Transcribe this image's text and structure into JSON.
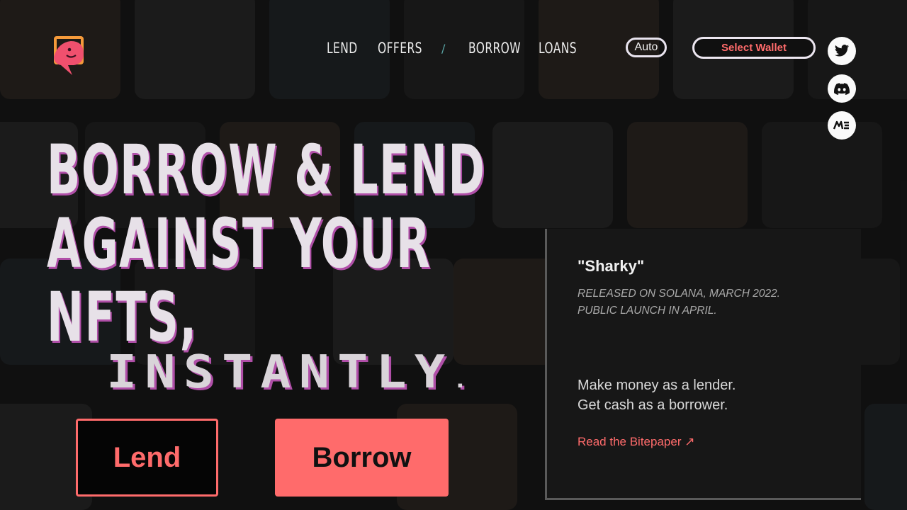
{
  "nav": {
    "items": [
      {
        "label": "LEND"
      },
      {
        "label": "OFFERS"
      },
      {
        "label": "BORROW"
      },
      {
        "label": "LOANS"
      }
    ],
    "separator": "/"
  },
  "theme_toggle": {
    "label": "Auto"
  },
  "wallet": {
    "label": "Select Wallet"
  },
  "social": {
    "icons": [
      "twitter-icon",
      "discord-icon",
      "magic-eden-icon"
    ]
  },
  "hero": {
    "line1": "BORROW & LEND",
    "line2": "AGAINST YOUR",
    "line3": "NFTS,",
    "accent_word": "INSTANTLY",
    "accent_punct": "."
  },
  "cta": {
    "lend_label": "Lend",
    "borrow_label": "Borrow"
  },
  "panel": {
    "title": "\"Sharky\"",
    "sub_line1": "RELEASED ON SOLANA, MARCH 2022.",
    "sub_line2": "PUBLIC LAUNCH IN APRIL.",
    "body_line1": "Make money as a lender.",
    "body_line2": "Get cash as a borrower.",
    "link_label": "Read the Bitepaper",
    "link_arrow": "↗"
  },
  "colors": {
    "accent": "#ff6b6b",
    "shadow": "#b04fa8",
    "background": "#141414"
  }
}
